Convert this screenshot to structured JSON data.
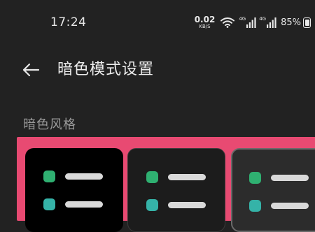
{
  "status": {
    "time": "17:24",
    "net_speed_value": "0.02",
    "net_speed_unit": "KB/S",
    "signal1_tag": "4G",
    "signal2_tag": "4G",
    "battery_percent": "85%"
  },
  "header": {
    "back_icon": "arrow-left-icon",
    "title": "暗色模式设置"
  },
  "section": {
    "label": "暗色风格"
  },
  "styles": {
    "selected_index": 0,
    "options": [
      {
        "background": "#000000",
        "dot_colors": [
          "#2fb071",
          "#35b3a8"
        ],
        "bar_color": "#d9d9d9"
      },
      {
        "background": "#1c1c1c",
        "dot_colors": [
          "#2fb071",
          "#35b3a8"
        ],
        "bar_color": "#d9d9d9"
      },
      {
        "background": "#2c2c2c",
        "dot_colors": [
          "#2fb071",
          "#35b3a8"
        ],
        "bar_color": "#d9d9d9"
      }
    ]
  },
  "colors": {
    "background": "#222222",
    "selection_accent": "#e84a72",
    "section_label": "#9a9a9a"
  }
}
